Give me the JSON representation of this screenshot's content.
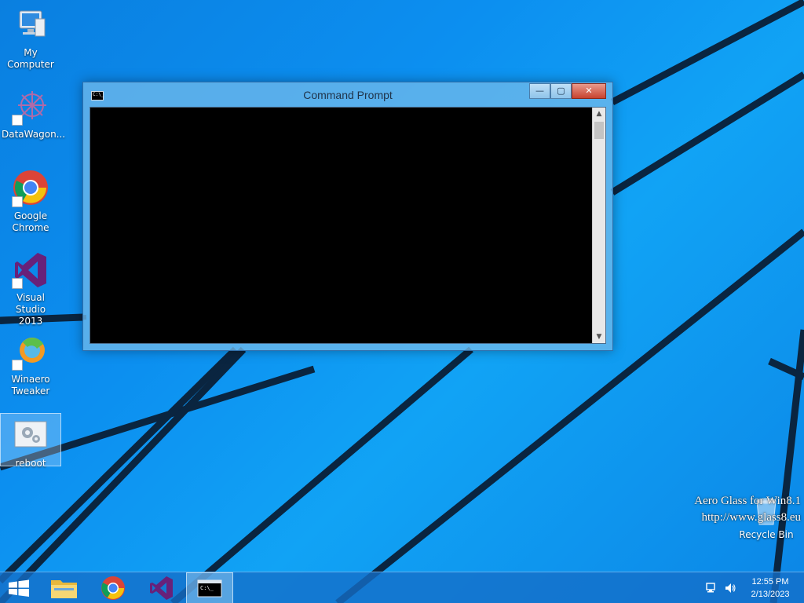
{
  "desktop": {
    "icons": [
      {
        "label": "My Computer",
        "icon": "computer-icon"
      },
      {
        "label": "DataWagon...",
        "icon": "datawagon-icon"
      },
      {
        "label_line1": "Google",
        "label_line2": "Chrome",
        "icon": "chrome-icon"
      },
      {
        "label_line1": "Visual Studio",
        "label_line2": "2013",
        "icon": "visual-studio-icon"
      },
      {
        "label_line1": "Winaero",
        "label_line2": "Tweaker",
        "icon": "winaero-tweaker-icon"
      },
      {
        "label": "reboot",
        "icon": "settings-file-icon"
      }
    ],
    "recycle_bin": {
      "label": "Recycle Bin",
      "icon": "recycle-bin-icon"
    }
  },
  "window": {
    "title": "Command Prompt",
    "app_icon": "cmd-icon",
    "icon_text": "C:\\_",
    "controls": {
      "minimize": "—",
      "maximize": "▢",
      "close": "✕"
    },
    "scroll_up": "▲",
    "scroll_down": "▼"
  },
  "watermark": {
    "line1": "Aero Glass for Win8.1",
    "line2": "http://www.glass8.eu"
  },
  "taskbar": {
    "buttons": [
      {
        "name": "start",
        "icon": "windows-start-icon"
      },
      {
        "name": "file-explorer",
        "icon": "file-explorer-icon"
      },
      {
        "name": "google-chrome",
        "icon": "chrome-icon"
      },
      {
        "name": "visual-studio",
        "icon": "visual-studio-icon"
      },
      {
        "name": "command-prompt",
        "icon": "cmd-icon",
        "active": true
      }
    ],
    "tray": {
      "network_icon": "network-icon",
      "volume_icon": "volume-icon",
      "time": "12:55 PM",
      "date": "2/13/2023"
    }
  },
  "colors": {
    "wallpaper": "#0c8ff0",
    "wallpaper_lines": "#0a2a4a",
    "taskbar": "#146ec8",
    "console_bg": "#000000",
    "close_button": "#c7432f"
  }
}
